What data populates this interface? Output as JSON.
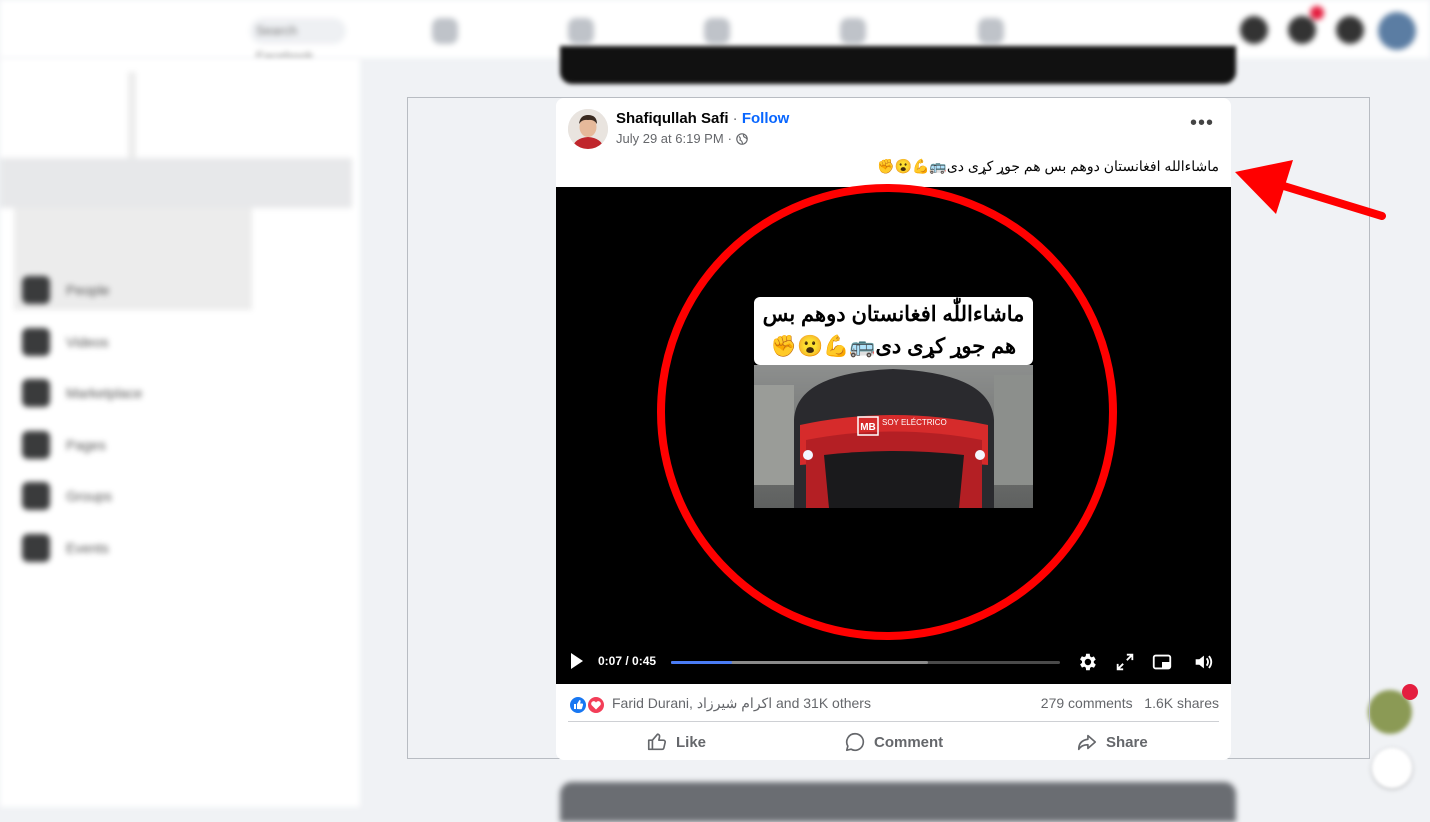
{
  "topbar": {
    "search_placeholder": "Search Facebook"
  },
  "sidebar": {
    "items": [
      {
        "label": "People",
        "icon": "people-icon"
      },
      {
        "label": "Videos",
        "icon": "videos-icon"
      },
      {
        "label": "Marketplace",
        "icon": "marketplace-icon"
      },
      {
        "label": "Pages",
        "icon": "pages-icon"
      },
      {
        "label": "Groups",
        "icon": "groups-icon"
      },
      {
        "label": "Events",
        "icon": "events-icon"
      }
    ]
  },
  "post": {
    "author": "Shafiqullah Safi",
    "separator": " · ",
    "follow_label": "Follow",
    "timestamp": "July 29 at 6:19 PM",
    "meta_sep": "·",
    "privacy_icon": "globe-icon",
    "caption": "ماشاءالله افغانستان دوهم بس هم جوړ کړی دی🚌💪😮✊",
    "video": {
      "caption_line1": "ماشاءاللّٰه افغانستان دوهم بس",
      "caption_line2": "هم جوړ کړی دی🚌💪😮✊",
      "bus_text": "SOY ELÉCTRICO",
      "bus_logo": "MB",
      "current_time": "0:07",
      "duration": "0:45",
      "time_display": "0:07 / 0:45",
      "progress_fraction": 0.156,
      "buffered_fraction": 0.66
    },
    "reactions_summary": "Farid Durani, اکرام شیرزاد and 31K others",
    "comments_count": "279 comments",
    "shares_count": "1.6K shares",
    "actions": {
      "like": "Like",
      "comment": "Comment",
      "share": "Share"
    }
  },
  "annotation_color": "#ff0000"
}
